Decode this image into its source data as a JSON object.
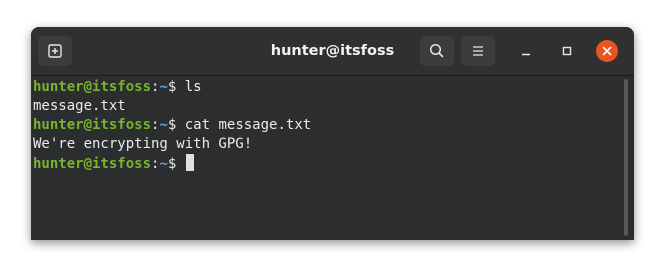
{
  "window": {
    "title": "hunter@itsfoss"
  },
  "icons": {
    "new_tab": "new-tab-icon",
    "search": "search-icon",
    "menu": "hamburger-menu-icon",
    "minimize": "minimize-icon",
    "maximize": "maximize-icon",
    "close": "close-icon"
  },
  "colors": {
    "prompt_user": "#77b52c",
    "prompt_path": "#6a9ed8",
    "close_button": "#e9541f",
    "terminal_bg": "#2b2d2e"
  },
  "terminal": {
    "lines": [
      {
        "type": "prompt",
        "user_host": "hunter@itsfoss",
        "sep": ":",
        "path": "~",
        "symbol": "$ ",
        "command": "ls"
      },
      {
        "type": "output",
        "text": "message.txt"
      },
      {
        "type": "prompt",
        "user_host": "hunter@itsfoss",
        "sep": ":",
        "path": "~",
        "symbol": "$ ",
        "command": "cat message.txt"
      },
      {
        "type": "output",
        "text": "We're encrypting with GPG!"
      },
      {
        "type": "prompt",
        "user_host": "hunter@itsfoss",
        "sep": ":",
        "path": "~",
        "symbol": "$ ",
        "command": ""
      }
    ]
  }
}
